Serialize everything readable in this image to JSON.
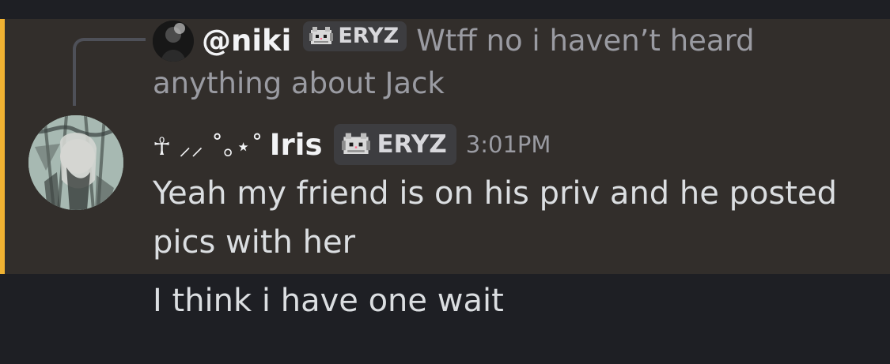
{
  "colors": {
    "background": "#1e1f24",
    "highlight_background": "#322e2b",
    "highlight_bar": "#f0b232",
    "tag_background": "#3d3d40",
    "muted_text": "#9a9ba2",
    "text": "#dbdee1"
  },
  "reply": {
    "username": "@niki",
    "tag_label": "ERYZ",
    "tag_icon": "cat-icon",
    "text": "Wtff no i haven’t heard anything about Jack"
  },
  "message": {
    "author_prefix": "☥ ⸝⸝ ˚｡⋆˚",
    "author_name": "Iris",
    "tag_label": "ERYZ",
    "tag_icon": "cat-icon",
    "timestamp": "3:01PM",
    "lines": [
      "Yeah my friend is on his priv and he posted",
      "pics with her"
    ]
  },
  "followup": {
    "text": "I think i have one wait"
  }
}
